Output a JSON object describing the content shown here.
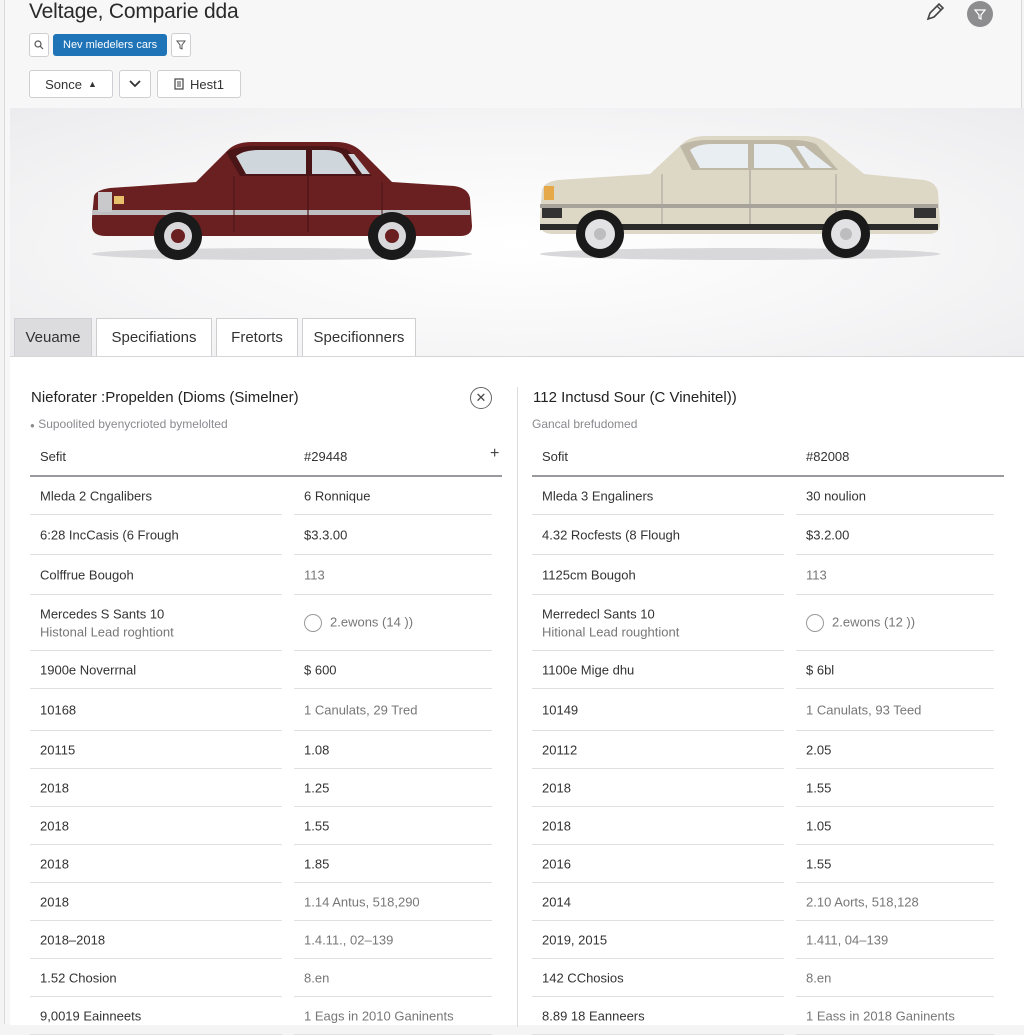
{
  "header": {
    "title": "Veltage, Comparie dda"
  },
  "search": {
    "left_icon": "search-icon",
    "chip_label": "Nev mledelers cars",
    "right_icon": "filter-icon"
  },
  "controls": {
    "sort_label": "Sonce",
    "heat_label": "Hest1"
  },
  "tabs": [
    {
      "label": "Veuame",
      "active": true
    },
    {
      "label": "Specifiations",
      "active": false
    },
    {
      "label": "Fretorts",
      "active": false
    },
    {
      "label": "Specifionners",
      "active": false
    }
  ],
  "cars": {
    "left": {
      "color": "#6a1f20"
    },
    "right": {
      "color": "#ddd7c6"
    }
  },
  "left_panel": {
    "title": "Nieforater :Propelden (Dioms (Simelner)",
    "subtitle": "Supoolited byenycrioted bymelolted",
    "header": {
      "col1": "Sefit",
      "col2": "#29448"
    },
    "rows": [
      {
        "c1": "Mleda 2 Cngalibers",
        "c2": "6 Ronnique"
      },
      {
        "c1": "6:28 IncCasis (6 Frough",
        "c2": "$3.3.00"
      },
      {
        "c1": "Colffrue Bougoh",
        "c2": "113"
      },
      {
        "c1": "Mercedes S Sants 10",
        "c1b": "Histonal Lead roghtiont",
        "c2": "2.ewons (14 ))"
      },
      {
        "c1": "1900e Noverrnal",
        "c2": "$ 600"
      },
      {
        "c1": "10168",
        "c2": "1 Canulats, 29 Tred"
      },
      {
        "c1": "20115",
        "c2": "1.08"
      },
      {
        "c1": "2018",
        "c2": "1.25"
      },
      {
        "c1": "2018",
        "c2": "1.55"
      },
      {
        "c1": "2018",
        "c2": "1.85"
      },
      {
        "c1": "2018",
        "c2": "1.14 Antus, 518,290"
      },
      {
        "c1": "2018–2018",
        "c2": "1.4.11., 02–139"
      },
      {
        "c1": "1.52 Chosion",
        "c2": "8.en"
      },
      {
        "c1": "9,0019 Eainneets",
        "c2": "1 Eags in 2010 Ganinents"
      }
    ]
  },
  "right_panel": {
    "title": "112 Inctusd Sour (C Vinehitel))",
    "subtitle": "Gancal brefudomed",
    "header": {
      "col1": "Sofit",
      "col2": "#82008"
    },
    "rows": [
      {
        "c1": "Mleda 3 Engaliners",
        "c2": "30 noulion"
      },
      {
        "c1": "4.32 Rocfests (8 Flough",
        "c2": "$3.2.00"
      },
      {
        "c1": "1125cm Bougoh",
        "c2": "113"
      },
      {
        "c1": "Merredecl Sants 10",
        "c1b": "Hitional Lead roughtiont",
        "c2": "2.ewons (12 ))"
      },
      {
        "c1": "1100e Mige dhu",
        "c2": "$ 6bl"
      },
      {
        "c1": "10149",
        "c2": "1 Canulats, 93 Teed"
      },
      {
        "c1": "20112",
        "c2": "2.05"
      },
      {
        "c1": "2018",
        "c2": "1.55"
      },
      {
        "c1": "2018",
        "c2": "1.05"
      },
      {
        "c1": "2016",
        "c2": "1.55"
      },
      {
        "c1": "2014",
        "c2": "2.10 Aorts, 518,128"
      },
      {
        "c1": "2019, 2015",
        "c2": "1.411, 04–139"
      },
      {
        "c1": "142 CChosios",
        "c2": "8.en"
      },
      {
        "c1": "8.89 18 Eanneers",
        "c2": "1 Eass in 2018 Ganinents"
      }
    ]
  }
}
